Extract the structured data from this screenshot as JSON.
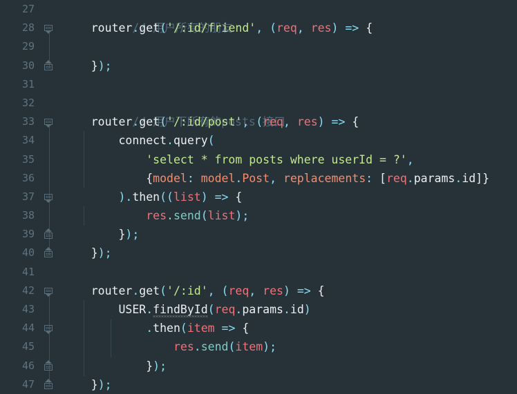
{
  "editor": {
    "theme_name": "material-dark",
    "background_color": "#263238",
    "gutter_text_color": "#5f7380",
    "language": "javascript",
    "first_visible_line": 27,
    "last_visible_line": 47
  },
  "colors": {
    "comment": "#546a7b",
    "string": "#c3e88d",
    "parameter": "#f07178",
    "method": "#80cbc4",
    "punctuation": "#89ddf3",
    "plain": "#eceff1",
    "key": "#f78c6c",
    "fold_marker": "#5a6e79",
    "indent_guide": "#37474f"
  },
  "lines": [
    {
      "number": "27",
      "fold": "none",
      "text": "    // 用户所有的朋友"
    },
    {
      "number": "28",
      "fold": "down",
      "text": "    router.get('/:id/friend', (req, res) => {"
    },
    {
      "number": "29",
      "fold": "none",
      "text": ""
    },
    {
      "number": "30",
      "fold": "up",
      "text": "    });"
    },
    {
      "number": "31",
      "fold": "none",
      "text": ""
    },
    {
      "number": "32",
      "fold": "none",
      "text": "    // 用户下所有的posts 接口"
    },
    {
      "number": "33",
      "fold": "down",
      "text": "    router.get('/:id/post', (req, res) => {"
    },
    {
      "number": "34",
      "fold": "none",
      "text": "        connect.query("
    },
    {
      "number": "35",
      "fold": "none",
      "text": "            'select * from posts where userId = ?',"
    },
    {
      "number": "36",
      "fold": "none",
      "text": "            {model: model.Post, replacements: [req.params.id]}"
    },
    {
      "number": "37",
      "fold": "down",
      "text": "        ).then((list) => {"
    },
    {
      "number": "38",
      "fold": "none",
      "text": "            res.send(list);"
    },
    {
      "number": "39",
      "fold": "up",
      "text": "        });"
    },
    {
      "number": "40",
      "fold": "up",
      "text": "    });"
    },
    {
      "number": "41",
      "fold": "none",
      "text": ""
    },
    {
      "number": "42",
      "fold": "down",
      "text": "    router.get('/:id', (req, res) => {"
    },
    {
      "number": "43",
      "fold": "none",
      "text": "        USER.findById(req.params.id)"
    },
    {
      "number": "44",
      "fold": "down",
      "text": "            .then(item => {"
    },
    {
      "number": "45",
      "fold": "none",
      "text": "                res.send(item);"
    },
    {
      "number": "46",
      "fold": "up",
      "text": "            });"
    },
    {
      "number": "47",
      "fold": "up",
      "text": "    });"
    }
  ],
  "diagnostics": [
    {
      "line": "43",
      "token": "findById",
      "kind": "unresolved-function-warning"
    }
  ]
}
